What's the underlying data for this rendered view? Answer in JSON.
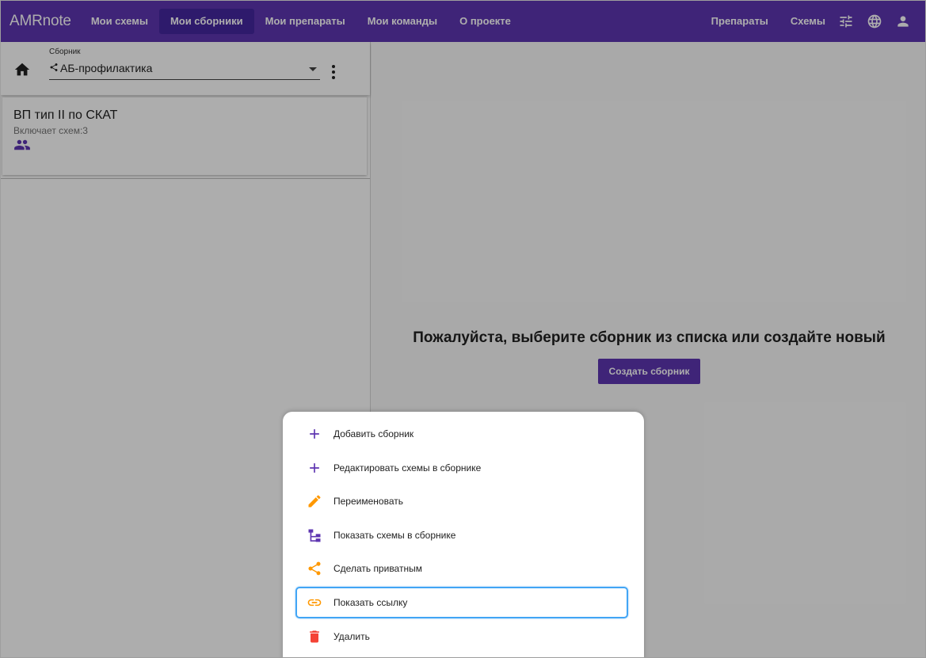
{
  "header": {
    "logo": "AMRnote",
    "nav": [
      {
        "label": "Мои схемы",
        "active": false
      },
      {
        "label": "Мои сборники",
        "active": true
      },
      {
        "label": "Мои препараты",
        "active": false
      },
      {
        "label": "Мои команды",
        "active": false
      },
      {
        "label": "О проекте",
        "active": false
      }
    ],
    "right_nav": [
      {
        "label": "Препараты"
      },
      {
        "label": "Схемы"
      }
    ],
    "icons": [
      "tune-icon",
      "language-icon",
      "account-icon"
    ]
  },
  "left_panel": {
    "select_label": "Сборник",
    "select_value": "АБ-профилактика",
    "card": {
      "title": "ВП тип II по СКАТ",
      "subtitle": "Включает схем:3",
      "icon": "people-icon"
    }
  },
  "main": {
    "message": "Пожалуйста, выберите сборник из списка или создайте новый",
    "create_button": "Создать сборник"
  },
  "menu": {
    "items": [
      {
        "label": "Добавить сборник",
        "icon": "plus-icon",
        "color": "#5e35b1"
      },
      {
        "label": "Редактировать схемы в сборнике",
        "icon": "plus-icon",
        "color": "#5e35b1"
      },
      {
        "label": "Переименовать",
        "icon": "pencil-icon",
        "color": "#ff9800"
      },
      {
        "label": "Показать схемы в сборнике",
        "icon": "schema-icon",
        "color": "#5e35b1"
      },
      {
        "label": "Сделать приватным",
        "icon": "share-icon",
        "color": "#ff9800"
      },
      {
        "label": "Показать ссылку",
        "icon": "link-icon",
        "color": "#ff9800",
        "focused": true
      },
      {
        "label": "Удалить",
        "icon": "trash-icon",
        "color": "#f44336"
      }
    ]
  },
  "colors": {
    "primary": "#5e35b1",
    "primary_dark": "#4527a0",
    "accent_orange": "#ff9800",
    "danger": "#f44336",
    "focus_ring": "#42a5f5"
  }
}
